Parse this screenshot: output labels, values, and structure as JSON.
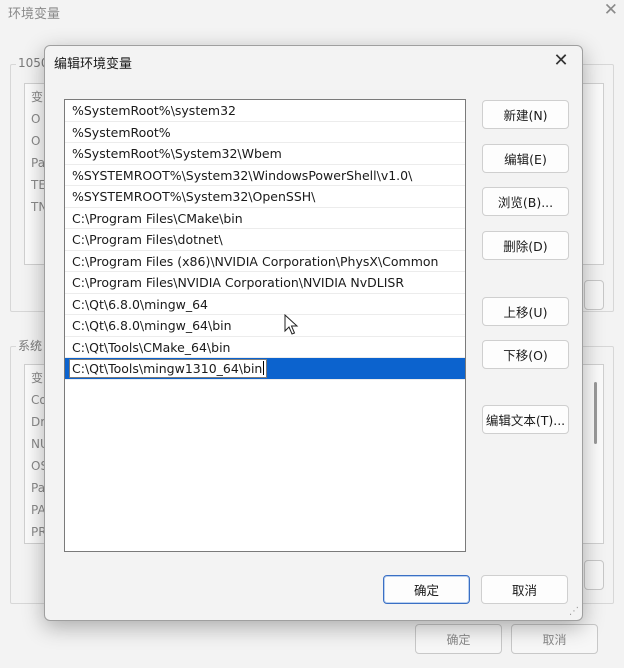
{
  "background_window": {
    "title": "环境变量",
    "close_glyph": "✕",
    "user_group_label": "1050",
    "user_rows": [
      "变",
      "O",
      "O",
      "Pa",
      "TE",
      "TN"
    ],
    "system_group_label": "系统",
    "system_rows": [
      "变",
      "Co",
      "Dr",
      "NU",
      "OS",
      "Pa",
      "PA",
      "PR"
    ],
    "ok_label": "确定",
    "cancel_label": "取消"
  },
  "dialog": {
    "title": "编辑环境变量",
    "close_glyph": "✕",
    "paths": [
      "%SystemRoot%\\system32",
      "%SystemRoot%",
      "%SystemRoot%\\System32\\Wbem",
      "%SYSTEMROOT%\\System32\\WindowsPowerShell\\v1.0\\",
      "%SYSTEMROOT%\\System32\\OpenSSH\\",
      "C:\\Program Files\\CMake\\bin",
      "C:\\Program Files\\dotnet\\",
      "C:\\Program Files (x86)\\NVIDIA Corporation\\PhysX\\Common",
      "C:\\Program Files\\NVIDIA Corporation\\NVIDIA NvDLISR",
      "C:\\Qt\\6.8.0\\mingw_64",
      "C:\\Qt\\6.8.0\\mingw_64\\bin",
      "C:\\Qt\\Tools\\CMake_64\\bin"
    ],
    "editing_value": "C:\\Qt\\Tools\\mingw1310_64\\bin",
    "buttons": {
      "new": "新建(N)",
      "edit": "编辑(E)",
      "browse": "浏览(B)...",
      "delete": "删除(D)",
      "move_up": "上移(U)",
      "move_down": "下移(O)",
      "edit_text": "编辑文本(T)..."
    },
    "ok_label": "确定",
    "cancel_label": "取消",
    "selection_color": "#0c63ce",
    "accent_color": "#3a6fc4"
  }
}
